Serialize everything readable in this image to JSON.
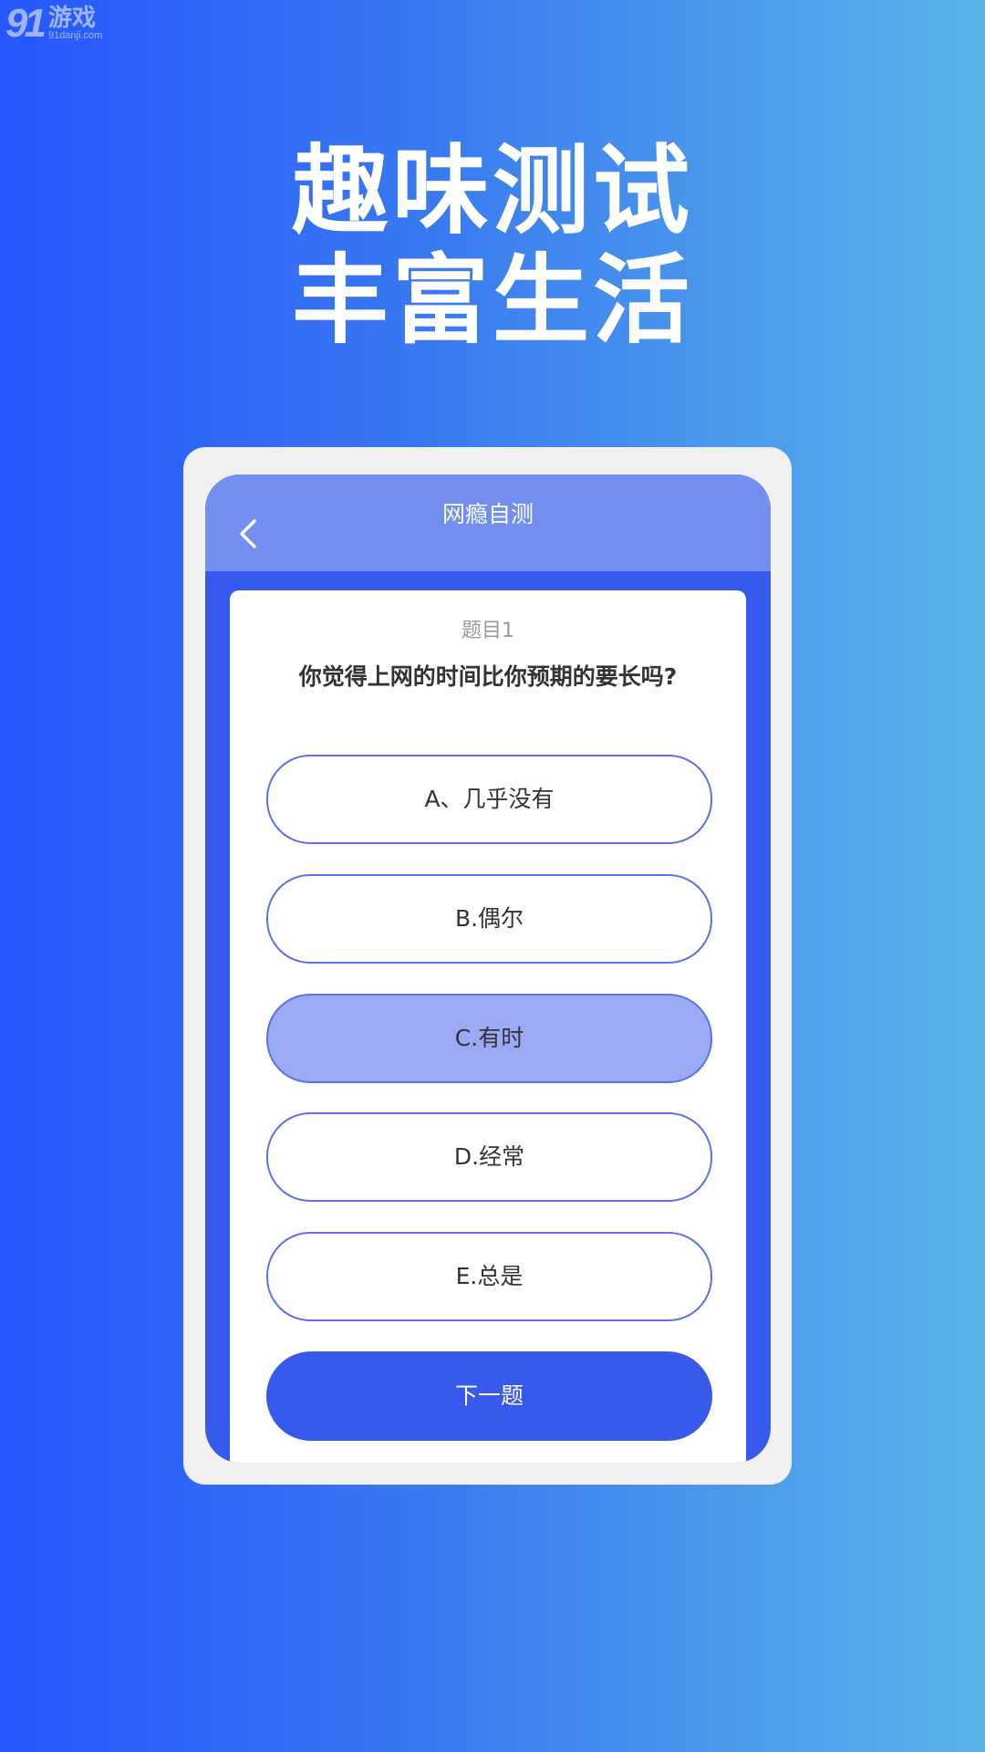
{
  "watermark": {
    "number": "91",
    "name": "游戏",
    "domain": "91danji.com"
  },
  "headline": {
    "line1": "趣味测试",
    "line2": "丰富生活"
  },
  "app": {
    "header_title": "网瘾自测",
    "back_icon": "chevron-left-icon"
  },
  "question": {
    "index_label": "题目1",
    "text": "你觉得上网的时间比你预期的要长吗?",
    "options": [
      {
        "label": "A、几乎没有",
        "selected": false
      },
      {
        "label": "B.偶尔",
        "selected": false
      },
      {
        "label": "C.有时",
        "selected": true
      },
      {
        "label": "D.经常",
        "selected": false
      },
      {
        "label": "E.总是",
        "selected": false
      }
    ]
  },
  "next_button": {
    "label": "下一题"
  },
  "colors": {
    "primary": "#375aec",
    "header": "#738ff0",
    "selected_option": "#9aaaf5",
    "option_border": "#5b73e8"
  }
}
